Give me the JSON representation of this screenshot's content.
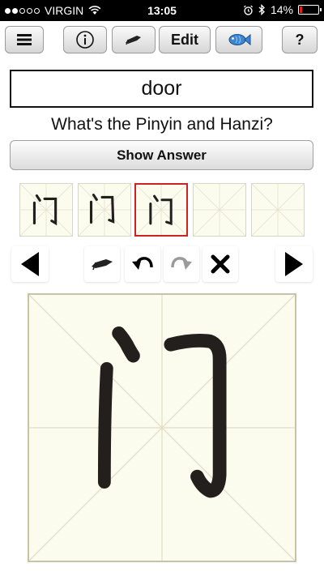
{
  "status_bar": {
    "carrier": "VIRGIN",
    "time": "13:05",
    "battery_text": "14%",
    "battery_level": 0.14,
    "signal_bars": 2,
    "signal_total": 5
  },
  "toolbar": {
    "menu_icon": "hamburger-menu-icon",
    "info_icon": "info-icon",
    "pen_icon": "pen-icon",
    "edit_label": "Edit",
    "fish_icon": "fish-icon",
    "help_label": "?"
  },
  "card": {
    "word": "door",
    "question": "What's the Pinyin and Hanzi?",
    "show_answer_label": "Show Answer"
  },
  "thumbnails": [
    {
      "state": "filled"
    },
    {
      "state": "filled"
    },
    {
      "state": "selected"
    },
    {
      "state": "empty"
    },
    {
      "state": "empty"
    }
  ],
  "controls": {
    "prev_icon": "left-arrow-icon",
    "pen_icon": "pen-icon",
    "undo_icon": "undo-icon",
    "redo_icon": "redo-icon",
    "clear_icon": "close-icon",
    "next_icon": "right-arrow-icon"
  },
  "colors": {
    "paper": "#fbfbee",
    "grid": "#e2ddc6",
    "ink": "#231f1d",
    "selected_border": "#cc2222",
    "battery": "#e02020"
  }
}
